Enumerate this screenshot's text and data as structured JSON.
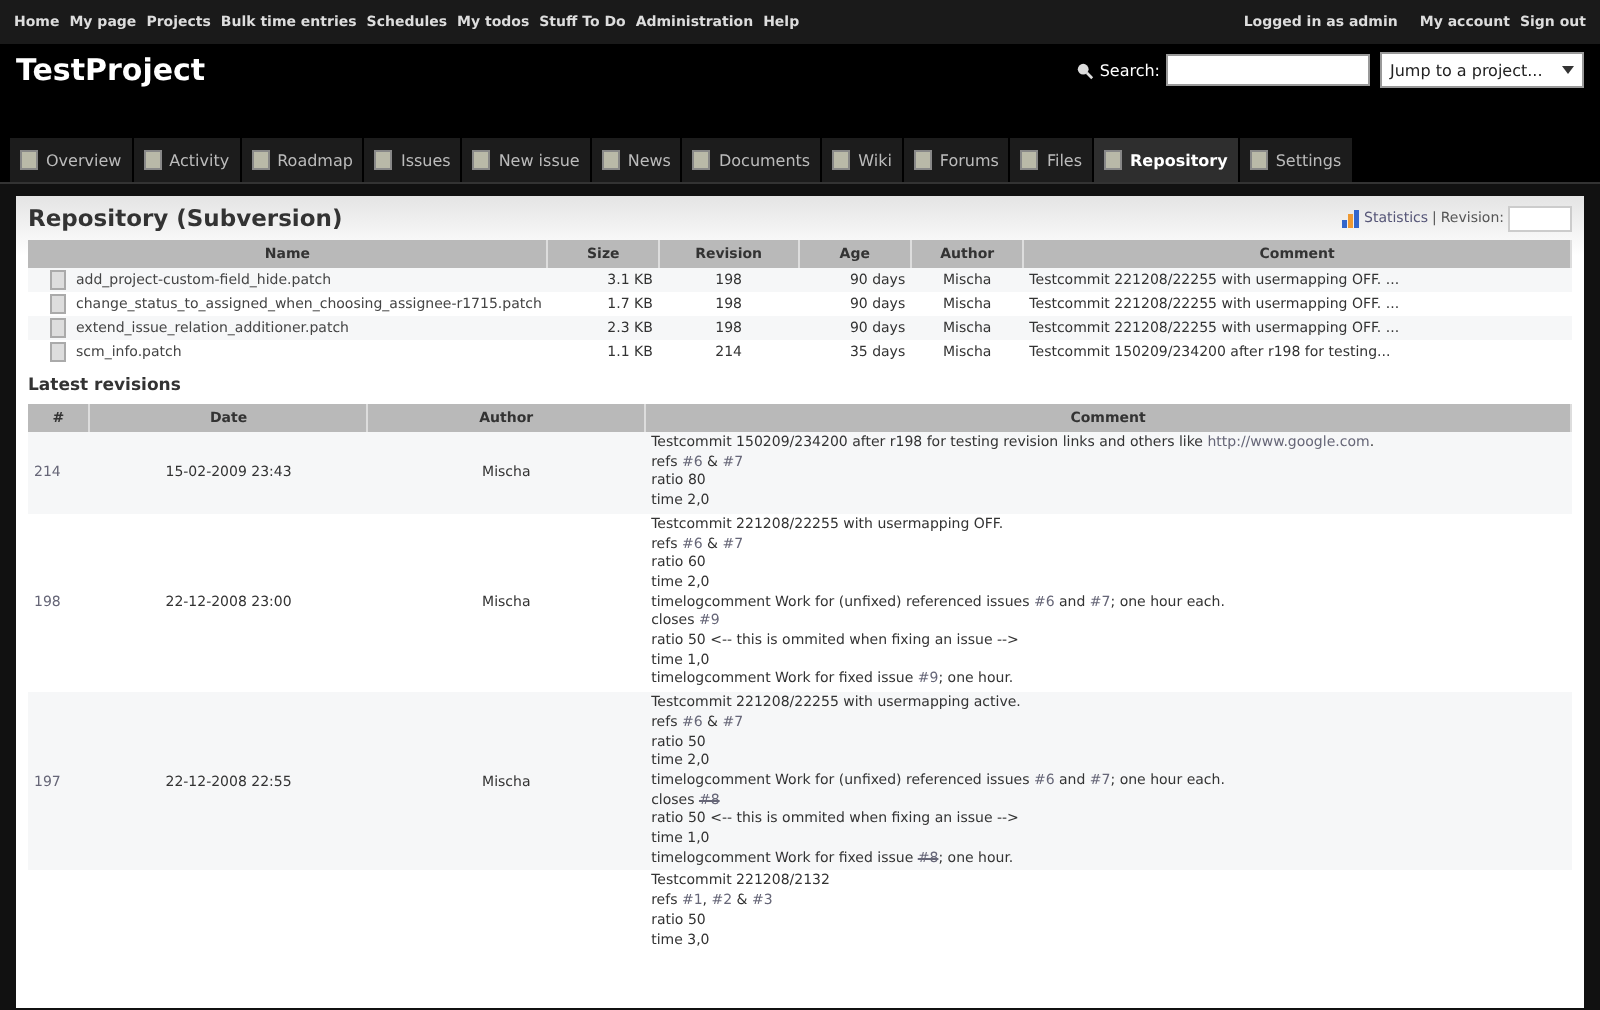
{
  "top_menu": {
    "left": [
      "Home",
      "My page",
      "Projects",
      "Bulk time entries",
      "Schedules",
      "My todos",
      "Stuff To Do",
      "Administration",
      "Help"
    ],
    "logged_in": "Logged in as admin",
    "right": [
      "My account",
      "Sign out"
    ]
  },
  "header": {
    "title": "TestProject",
    "search_label": "Search:",
    "jump": "Jump to a project..."
  },
  "tabs": [
    {
      "label": "Overview",
      "selected": false
    },
    {
      "label": "Activity",
      "selected": false
    },
    {
      "label": "Roadmap",
      "selected": false
    },
    {
      "label": "Issues",
      "selected": false
    },
    {
      "label": "New issue",
      "selected": false
    },
    {
      "label": "News",
      "selected": false
    },
    {
      "label": "Documents",
      "selected": false
    },
    {
      "label": "Wiki",
      "selected": false
    },
    {
      "label": "Forums",
      "selected": false
    },
    {
      "label": "Files",
      "selected": false
    },
    {
      "label": "Repository",
      "selected": true
    },
    {
      "label": "Settings",
      "selected": false
    }
  ],
  "page": {
    "title": "Repository (Subversion)",
    "statistics": "Statistics",
    "separator": "|",
    "revision_label": "Revision:"
  },
  "files": {
    "columns": [
      "Name",
      "Size",
      "Revision",
      "Age",
      "Author",
      "Comment"
    ],
    "rows": [
      [
        "add_project-custom-field_hide.patch",
        "3.1 KB",
        "198",
        "90 days",
        "Mischa",
        "Testcommit 221208/22255 with usermapping OFF. ..."
      ],
      [
        "change_status_to_assigned_when_choosing_assignee-r1715.patch",
        "1.7 KB",
        "198",
        "90 days",
        "Mischa",
        "Testcommit 221208/22255 with usermapping OFF. ..."
      ],
      [
        "extend_issue_relation_additioner.patch",
        "2.3 KB",
        "198",
        "90 days",
        "Mischa",
        "Testcommit 221208/22255 with usermapping OFF. ..."
      ],
      [
        "scm_info.patch",
        "1.1 KB",
        "214",
        "35 days",
        "Mischa",
        "Testcommit 150209/234200 after r198 for testing..."
      ]
    ]
  },
  "revisions_title": "Latest revisions",
  "revisions": {
    "columns": [
      "#",
      "Date",
      "Author",
      "Comment"
    ],
    "rows": [
      {
        "rev": "214",
        "date": "15-02-2009 23:43",
        "author": "Mischa",
        "lines": [
          [
            {
              "kind": "text",
              "text": "Testcommit 150209/234200 after r198 for testing revision links and others like "
            },
            {
              "kind": "link",
              "text": "http://www.google.com"
            },
            {
              "kind": "text",
              "text": "."
            }
          ],
          [
            {
              "kind": "text",
              "text": "refs "
            },
            {
              "kind": "link",
              "text": "#6"
            },
            {
              "kind": "text",
              "text": " & "
            },
            {
              "kind": "link",
              "text": "#7"
            }
          ],
          [
            {
              "kind": "text",
              "text": "ratio 80"
            }
          ],
          [
            {
              "kind": "text",
              "text": "time 2,0"
            }
          ]
        ]
      },
      {
        "rev": "198",
        "date": "22-12-2008 23:00",
        "author": "Mischa",
        "lines": [
          [
            {
              "kind": "text",
              "text": "Testcommit 221208/22255 with usermapping OFF."
            }
          ],
          [
            {
              "kind": "text",
              "text": "refs "
            },
            {
              "kind": "link",
              "text": "#6"
            },
            {
              "kind": "text",
              "text": " & "
            },
            {
              "kind": "link",
              "text": "#7"
            }
          ],
          [
            {
              "kind": "text",
              "text": "ratio 60"
            }
          ],
          [
            {
              "kind": "text",
              "text": "time 2,0"
            }
          ],
          [
            {
              "kind": "text",
              "text": "timelogcomment Work for (unfixed) referenced issues "
            },
            {
              "kind": "link",
              "text": "#6"
            },
            {
              "kind": "text",
              "text": " and "
            },
            {
              "kind": "link",
              "text": "#7"
            },
            {
              "kind": "text",
              "text": "; one hour each."
            }
          ],
          [
            {
              "kind": "text",
              "text": "closes "
            },
            {
              "kind": "link",
              "text": "#9"
            }
          ],
          [
            {
              "kind": "text",
              "text": "ratio 50 <-- this is ommited when fixing an issue -->"
            }
          ],
          [
            {
              "kind": "text",
              "text": "time 1,0"
            }
          ],
          [
            {
              "kind": "text",
              "text": "timelogcomment Work for fixed issue "
            },
            {
              "kind": "link",
              "text": "#9"
            },
            {
              "kind": "text",
              "text": "; one hour."
            }
          ]
        ]
      },
      {
        "rev": "197",
        "date": "22-12-2008 22:55",
        "author": "Mischa",
        "lines": [
          [
            {
              "kind": "text",
              "text": "Testcommit 221208/22255 with usermapping active."
            }
          ],
          [
            {
              "kind": "text",
              "text": "refs "
            },
            {
              "kind": "link",
              "text": "#6"
            },
            {
              "kind": "text",
              "text": " & "
            },
            {
              "kind": "link",
              "text": "#7"
            }
          ],
          [
            {
              "kind": "text",
              "text": "ratio 50"
            }
          ],
          [
            {
              "kind": "text",
              "text": "time 2,0"
            }
          ],
          [
            {
              "kind": "text",
              "text": "timelogcomment Work for (unfixed) referenced issues "
            },
            {
              "kind": "link",
              "text": "#6"
            },
            {
              "kind": "text",
              "text": " and "
            },
            {
              "kind": "link",
              "text": "#7"
            },
            {
              "kind": "text",
              "text": "; one hour each."
            }
          ],
          [
            {
              "kind": "text",
              "text": "closes "
            },
            {
              "kind": "closed",
              "text": "#8"
            }
          ],
          [
            {
              "kind": "text",
              "text": "ratio 50 <-- this is ommited when fixing an issue -->"
            }
          ],
          [
            {
              "kind": "text",
              "text": "time 1,0"
            }
          ],
          [
            {
              "kind": "text",
              "text": "timelogcomment Work for fixed issue "
            },
            {
              "kind": "closed",
              "text": "#8"
            },
            {
              "kind": "text",
              "text": "; one hour."
            }
          ]
        ]
      },
      {
        "lines": [
          [
            {
              "kind": "text",
              "text": "Testcommit 221208/2132"
            }
          ],
          [
            {
              "kind": "text",
              "text": "refs "
            },
            {
              "kind": "link",
              "text": "#1"
            },
            {
              "kind": "text",
              "text": ", "
            },
            {
              "kind": "link",
              "text": "#2"
            },
            {
              "kind": "text",
              "text": " & "
            },
            {
              "kind": "link",
              "text": "#3"
            }
          ],
          [
            {
              "kind": "text",
              "text": "ratio 50"
            }
          ],
          [
            {
              "kind": "text",
              "text": "time 3,0"
            }
          ]
        ]
      }
    ]
  }
}
